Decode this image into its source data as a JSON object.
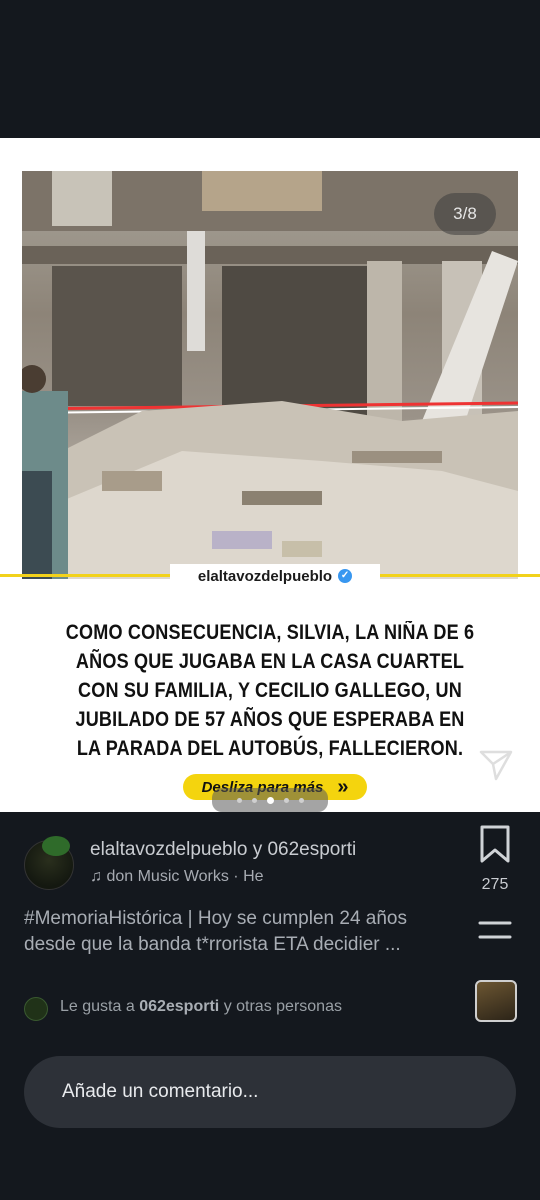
{
  "post": {
    "slide_counter": "3/8",
    "brand_handle": "elaltavozdelpueblo",
    "headline": "COMO CONSECUENCIA, SILVIA, LA NIÑA DE 6 AÑOS QUE JUGABA EN LA CASA CUARTEL CON SU FAMILIA, Y CECILIO GALLEGO, UN JUBILADO DE 57 AÑOS QUE ESPERABA EN LA PARADA DEL AUTOBÚS, FALLECIERON.",
    "swipe_label": "Desliza para más",
    "swipe_arrow": "»",
    "slides_total": 5,
    "slide_active_index": 2
  },
  "author": {
    "username": "elaltavozdelpueblo",
    "connector": "y",
    "coauthor": "062esporti",
    "music_icon": "music-note-icon",
    "music_text": "don Music Works · He"
  },
  "caption": {
    "text": "#MemoriaHistórica | Hoy se cumplen 24 años desde que la banda t*rrorista ETA decidier ..."
  },
  "likes": {
    "prefix": "Le gusta a",
    "user": "062esporti",
    "suffix": "y otras personas"
  },
  "actions": {
    "save_count": "275"
  },
  "comment": {
    "placeholder": "Añade un comentario..."
  }
}
